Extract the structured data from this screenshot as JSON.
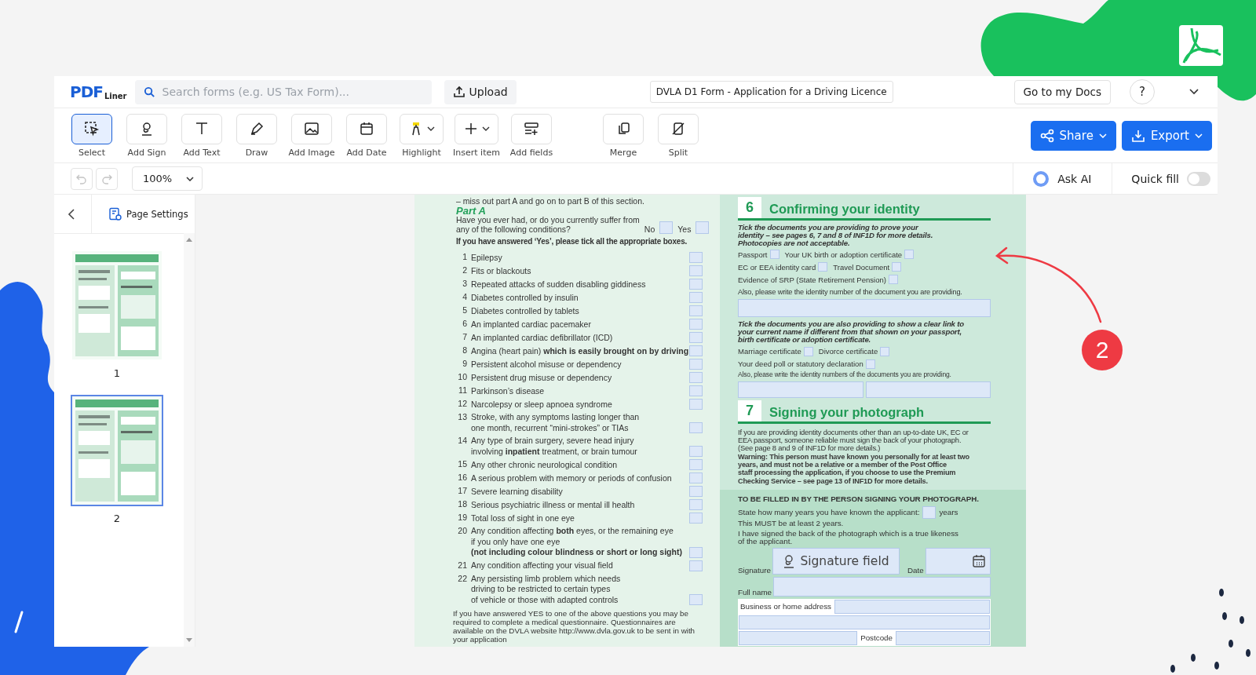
{
  "header": {
    "logo_main": "PDF",
    "logo_sub": "Liner",
    "search": {
      "placeholder": "Search forms (e.g. US Tax Form)..."
    },
    "upload": "Upload",
    "doc_title": "DVLA D1 Form - Application for a Driving Licence",
    "docs_button": "Go to my Docs",
    "help": "?"
  },
  "tools": [
    {
      "label": "Select",
      "selected": true,
      "dropdown": false
    },
    {
      "label": "Add Sign",
      "selected": false,
      "dropdown": false
    },
    {
      "label": "Add Text",
      "selected": false,
      "dropdown": false
    },
    {
      "label": "Draw",
      "selected": false,
      "dropdown": false
    },
    {
      "label": "Add Image",
      "selected": false,
      "dropdown": false
    },
    {
      "label": "Add Date",
      "selected": false,
      "dropdown": false
    },
    {
      "label": "Highlight",
      "selected": false,
      "dropdown": true
    },
    {
      "label": "Insert item",
      "selected": false,
      "dropdown": true
    },
    {
      "label": "Add fields",
      "selected": false,
      "dropdown": false
    }
  ],
  "page_tools": [
    {
      "label": "Merge"
    },
    {
      "label": "Split"
    }
  ],
  "share": "Share",
  "export": "Export",
  "history": [
    {
      "kind": "undo",
      "disabled": true
    },
    {
      "kind": "redo",
      "disabled": true
    }
  ],
  "zoom": "100%",
  "ask_ai": "Ask AI",
  "quick_fill": {
    "label": "Quick fill",
    "on": false
  },
  "sidebar": {
    "page_settings": "Page Settings",
    "pages": [
      {
        "label": "1",
        "selected": false
      },
      {
        "label": "2",
        "selected": true
      }
    ]
  },
  "left": {
    "intro": "– miss out part A and go on to part B of this section.",
    "part": "Part A",
    "question": [
      "Have you ever had, or do you currently suffer from",
      "any of the following conditions?"
    ],
    "options": [
      {
        "label": "No",
        "checked": false
      },
      {
        "label": "Yes",
        "checked": false
      }
    ],
    "instruction": "If you have answered ‘Yes’, please tick all the appropriate boxes.",
    "conditions": [
      {
        "number": "1",
        "lines": [
          "Epilepsy"
        ],
        "checked": false
      },
      {
        "number": "2",
        "lines": [
          "Fits or blackouts"
        ],
        "checked": false
      },
      {
        "number": "3",
        "lines": [
          "Repeated attacks of sudden disabling giddiness"
        ],
        "checked": false
      },
      {
        "number": "4",
        "lines": [
          "Diabetes controlled by insulin"
        ],
        "checked": false
      },
      {
        "number": "5",
        "lines": [
          "Diabetes controlled by tablets"
        ],
        "checked": false
      },
      {
        "number": "6",
        "lines": [
          "An implanted cardiac pacemaker"
        ],
        "checked": false
      },
      {
        "number": "7",
        "lines": [
          "An implanted cardiac defibrillator (ICD)"
        ],
        "checked": false
      },
      {
        "number": "8",
        "lines": [
          "Angina (heart pain) **which is easily brought on by driving**"
        ],
        "checked": false
      },
      {
        "number": "9",
        "lines": [
          "Persistent alcohol misuse or dependency"
        ],
        "checked": false
      },
      {
        "number": "10",
        "lines": [
          "Persistent drug misuse or dependency"
        ],
        "checked": false
      },
      {
        "number": "11",
        "lines": [
          "Parkinson’s disease"
        ],
        "checked": false
      },
      {
        "number": "12",
        "lines": [
          "Narcolepsy or sleep apnoea syndrome"
        ],
        "checked": false
      },
      {
        "number": "13",
        "lines": [
          "Stroke, with any symptoms lasting longer than",
          "one month, recurrent “mini-strokes” or TIAs"
        ],
        "checked": false
      },
      {
        "number": "14",
        "lines": [
          "Any type of brain surgery, severe head injury",
          "involving **inpatient** treatment, or brain tumour"
        ],
        "checked": false
      },
      {
        "number": "15",
        "lines": [
          "Any other chronic neurological condition"
        ],
        "checked": false
      },
      {
        "number": "16",
        "lines": [
          "A serious problem with memory or periods of confusion"
        ],
        "checked": false
      },
      {
        "number": "17",
        "lines": [
          "Severe learning disability"
        ],
        "checked": false
      },
      {
        "number": "18",
        "lines": [
          "Serious psychiatric illness or mental ill health"
        ],
        "checked": false
      },
      {
        "number": "19",
        "lines": [
          "Total loss of sight in one eye"
        ],
        "checked": false
      },
      {
        "number": "20",
        "lines": [
          "Any condition affecting **both** eyes, or the remaining eye",
          "if you only have one eye",
          "**(not including colour blindness or short or long sight)**"
        ],
        "checked": false
      },
      {
        "number": "21",
        "lines": [
          "Any condition affecting your visual field"
        ],
        "checked": false
      },
      {
        "number": "22",
        "lines": [
          "Any persisting limb problem which needs",
          "driving to be restricted to certain types",
          "of vehicle or those with adapted controls"
        ],
        "checked": false
      }
    ],
    "note": [
      "If you have answered YES to one of the above questions you may be",
      "required to complete a medical questionnaire. Questionnaires are",
      "available on the DVLA website http://www.dvla.gov.uk to be sent in with",
      "your application"
    ]
  },
  "identity": {
    "number": "6",
    "title": "Confirming your identity",
    "instruction": [
      "Tick the documents you are providing to prove your",
      "identity – see pages 6, 7 and 8 of INF1D for more details.",
      "Photocopies are not acceptable."
    ],
    "doc_rows": [
      [
        {
          "label": "Passport",
          "checked": false
        },
        {
          "label": "Your UK birth or adoption certificate",
          "checked": false
        }
      ],
      [
        {
          "label": "EC or EEA identity card",
          "checked": false
        },
        {
          "label": "Travel Document",
          "checked": false
        }
      ],
      [
        {
          "label": "Evidence of SRP (State Retirement Pension)",
          "checked": false
        }
      ]
    ],
    "number_prompt": "Also, please write the identity number of the document you are providing.",
    "link_instruction": [
      "Tick the documents you are also providing to show a clear link to",
      "your current name if different from that shown on your passport,",
      "birth certificate or adoption certificate."
    ],
    "link_rows": [
      [
        {
          "label": "Marriage certificate",
          "checked": false
        },
        {
          "label": "Divorce certificate",
          "checked": false
        }
      ],
      [
        {
          "label": "Your deed poll or statutory declaration",
          "checked": false
        }
      ]
    ],
    "numbers_prompt": "Also, please write the identity numbers of the documents you are providing."
  },
  "photo": {
    "number": "7",
    "title": "Signing your photograph",
    "intro": [
      "If you are providing identity documents other than an up-to-date UK, EC or",
      "EEA passport, someone reliable must sign the back of your photograph.",
      "(See page 8 and 9 of INF1D for more details.)"
    ],
    "warning": [
      "Warning: This person must have known you personally for at least two",
      "years, and must not be a relative or a member of the Post Office",
      "staff processing the application, if you choose to use the Premium",
      "Checking Service – see page 13 of INF1D for more details."
    ],
    "signer_heading": "TO BE FILLED IN BY THE PERSON SIGNING YOUR PHOTOGRAPH.",
    "years_prompt": "State how many years you have known the applicant:",
    "years_unit": "years",
    "years_note": "This MUST be at least 2 years.",
    "declaration": [
      "I have signed the back of the photograph which is a true likeness",
      "of the applicant."
    ],
    "signature_label": "Signature",
    "signature_field": "Signature field",
    "date_label": "Date",
    "full_name_label": "Full name",
    "address_label": "Business or home address",
    "postcode_label": "Postcode"
  },
  "callout": "2"
}
